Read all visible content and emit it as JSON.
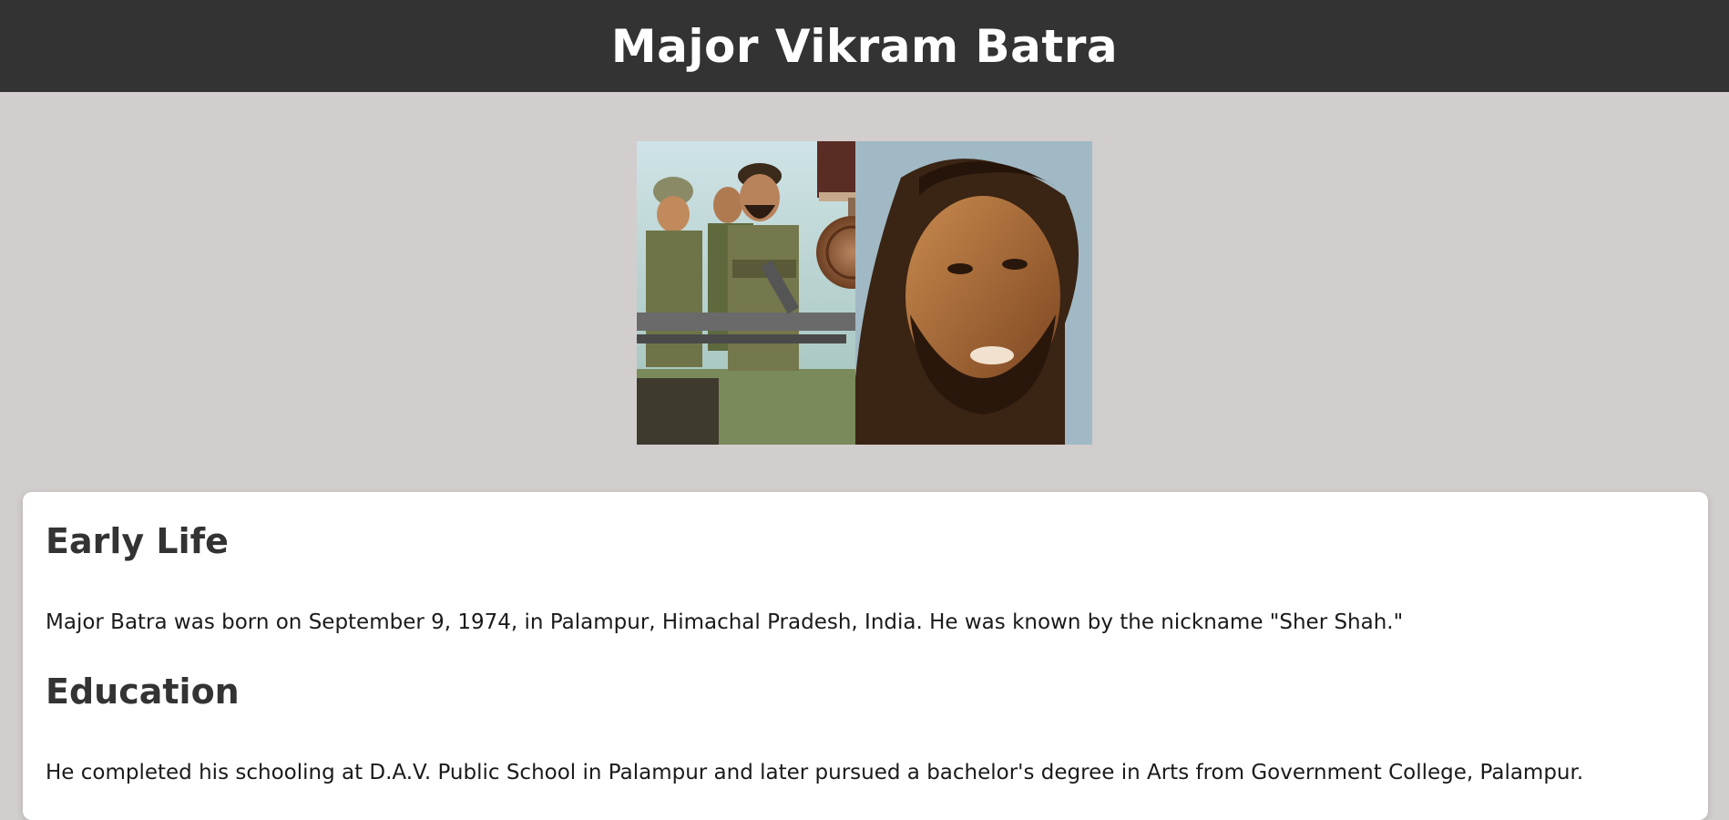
{
  "header": {
    "title": "Major Vikram Batra"
  },
  "hero": {
    "image_alt": "Major Vikram Batra with soldiers and Param Vir Chakra medal"
  },
  "sections": [
    {
      "heading": "Early Life",
      "text": "Major Batra was born on September 9, 1974, in Palampur, Himachal Pradesh, India. He was known by the nickname \"Sher Shah.\""
    },
    {
      "heading": "Education",
      "text": "He completed his schooling at D.A.V. Public School in Palampur and later pursued a bachelor's degree in Arts from Government College, Palampur."
    }
  ],
  "colors": {
    "header_bg": "#333333",
    "page_bg": "#d2cecd",
    "card_bg": "#ffffff",
    "heading": "#333333"
  }
}
